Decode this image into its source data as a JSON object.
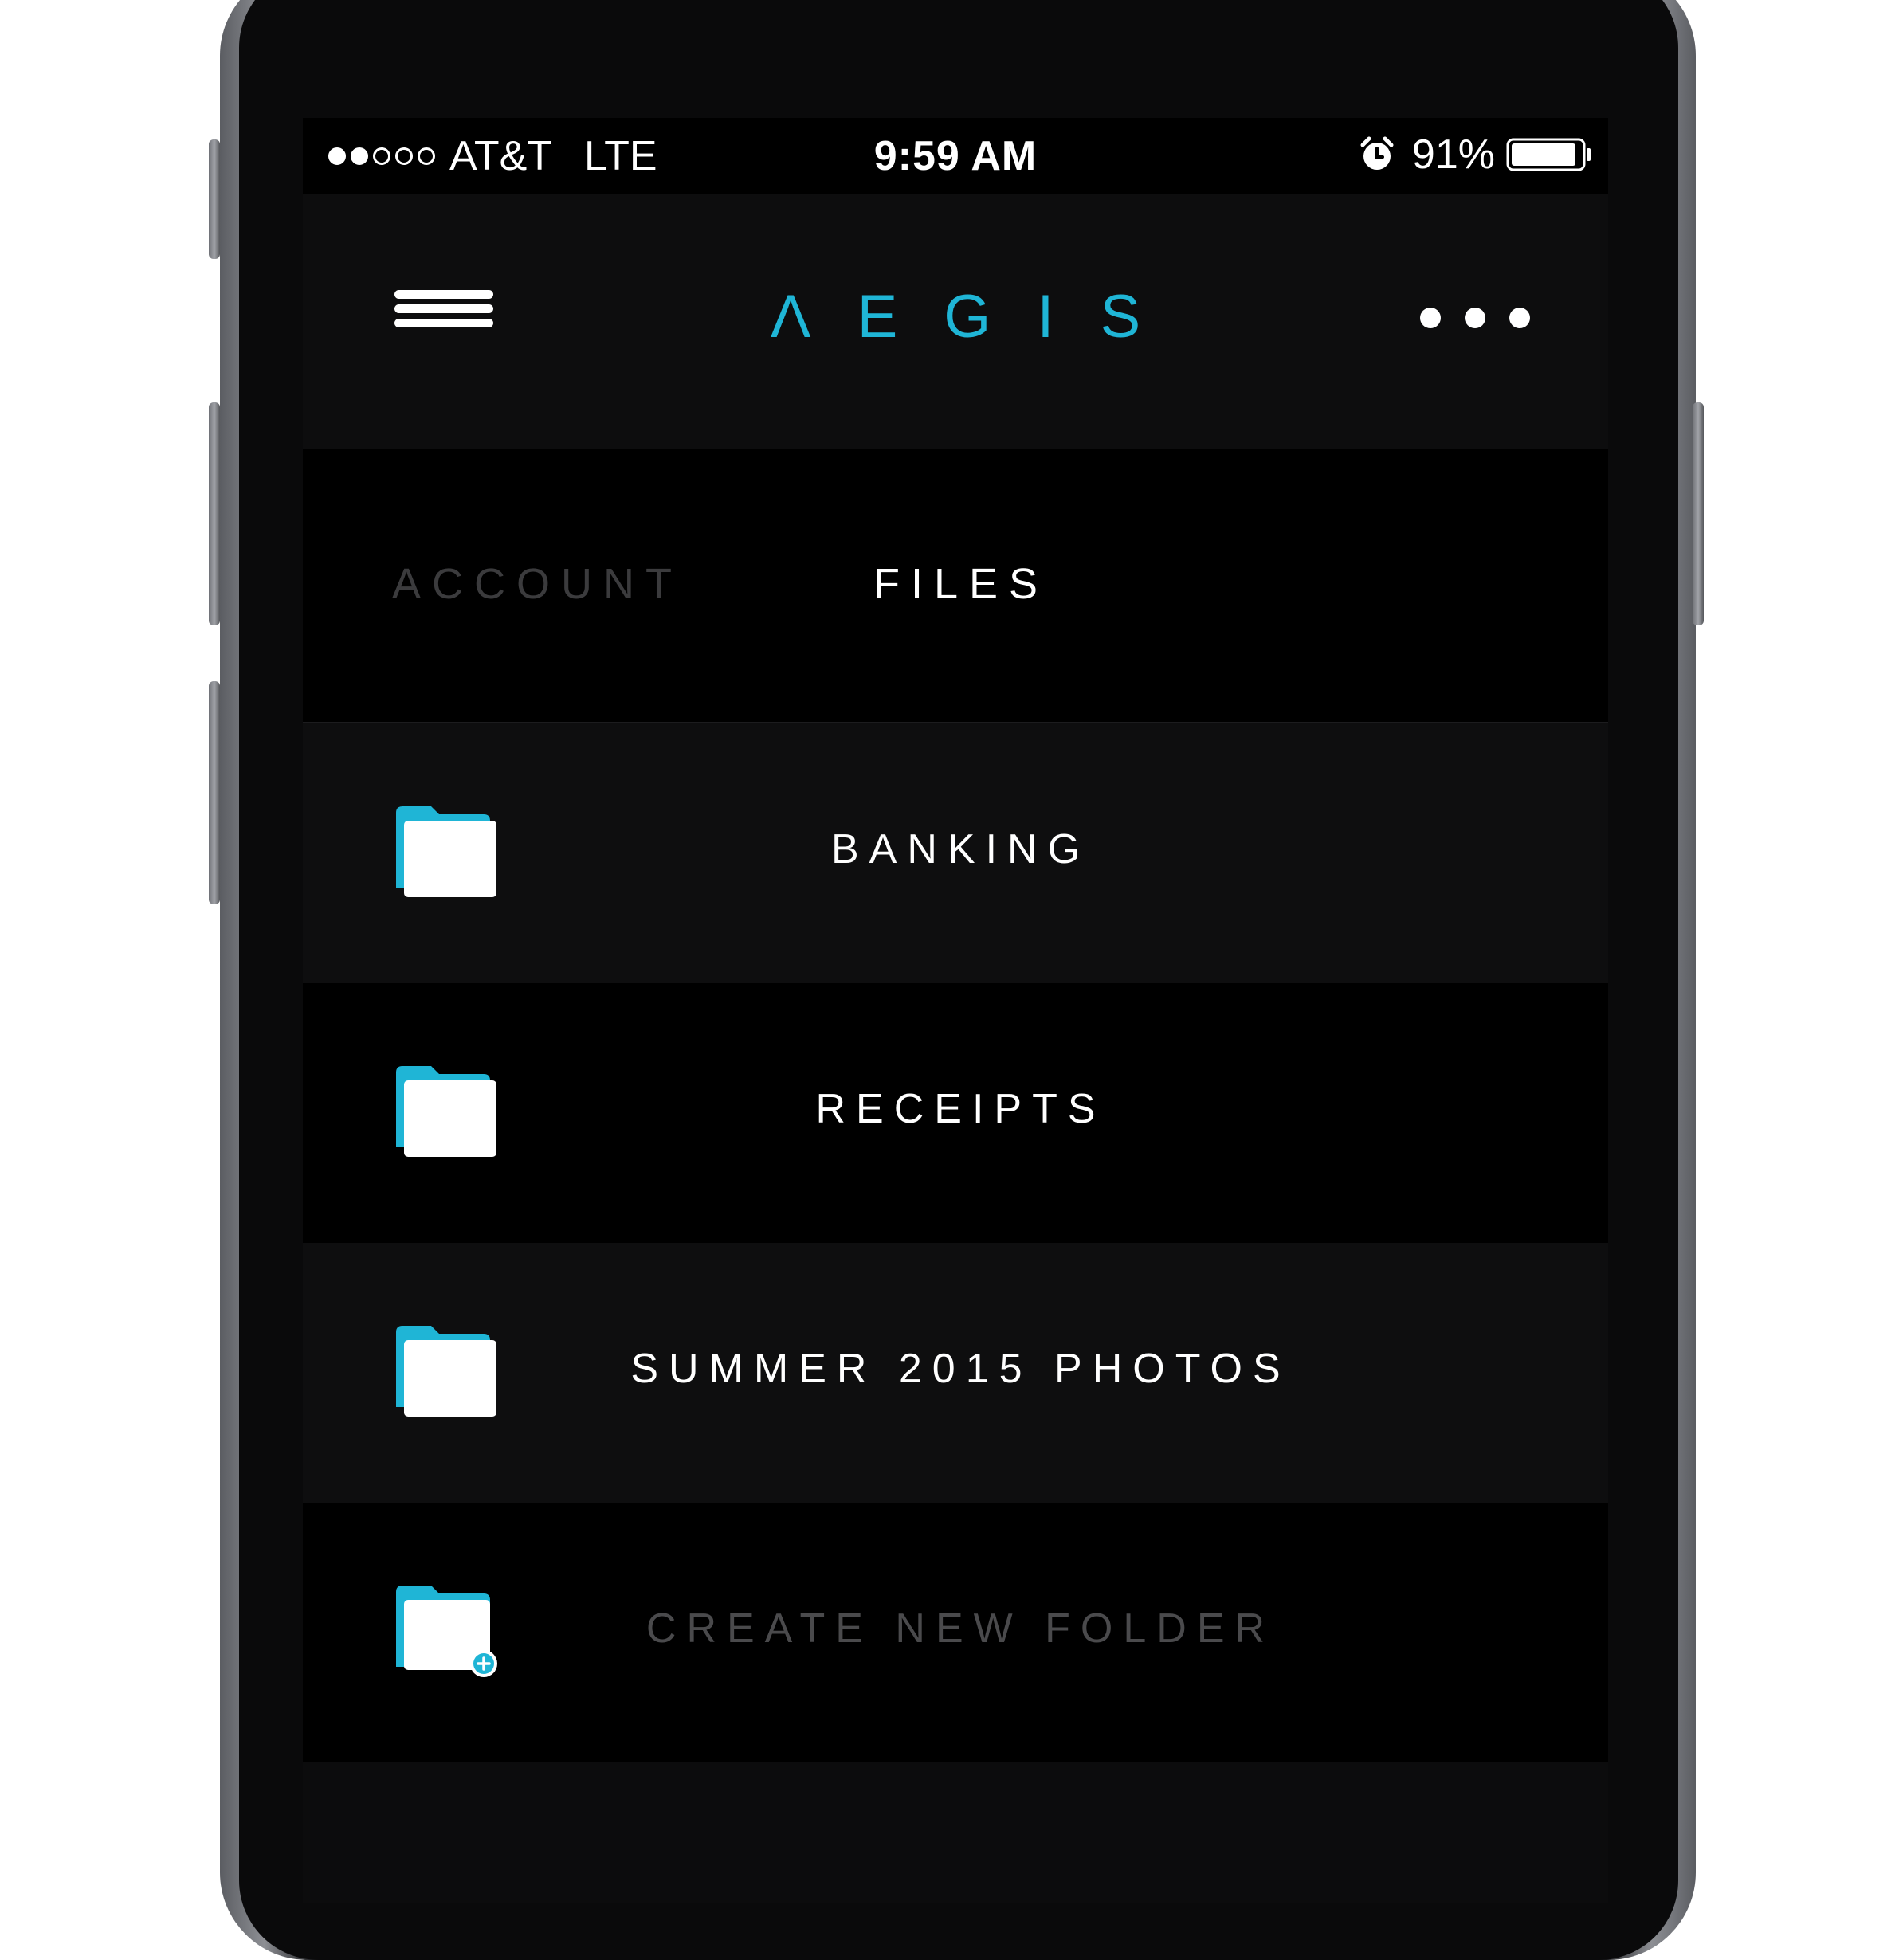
{
  "status_bar": {
    "signal": "●●○○○",
    "carrier": "AT&T",
    "network": "LTE",
    "time": "9:59 AM",
    "alarm_icon": "alarm-clock-icon",
    "battery_percent": "91%",
    "battery_level": 0.91
  },
  "header": {
    "title": "ΛEGIS",
    "menu_icon": "hamburger-menu-icon",
    "more_icon": "more-options-icon",
    "accent_color": "#1fb5d6"
  },
  "tabs": [
    {
      "label": "ACCOUNT",
      "active": false
    },
    {
      "label": "FILES",
      "active": true
    }
  ],
  "folders": [
    {
      "name": "BANKING",
      "icon": "folder-icon"
    },
    {
      "name": "RECEIPTS",
      "icon": "folder-icon"
    },
    {
      "name": "SUMMER 2015 PHOTOS",
      "icon": "folder-icon"
    }
  ],
  "create_folder": {
    "label": "CREATE NEW FOLDER",
    "icon": "add-folder-icon"
  }
}
